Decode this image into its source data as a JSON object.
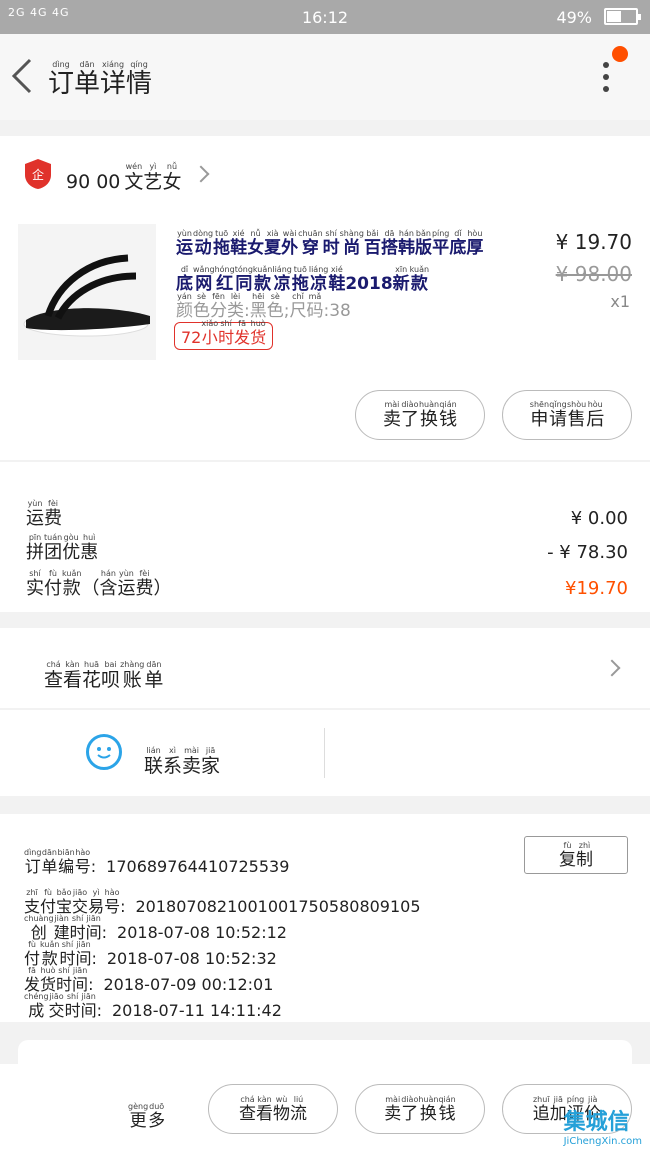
{
  "status_bar": {
    "signal": "2G 4G 4G",
    "time": "16:12",
    "battery": "49%"
  },
  "header": {
    "title": [
      {
        "py": "dìng",
        "hz": "订"
      },
      {
        "py": "dān",
        "hz": "单"
      },
      {
        "py": "xiáng",
        "hz": "详"
      },
      {
        "py": "qíng",
        "hz": "情"
      }
    ]
  },
  "shop": {
    "name_prefix": "90 00",
    "name": [
      {
        "py": "wén",
        "hz": "文"
      },
      {
        "py": "yì",
        "hz": "艺"
      },
      {
        "py": "nǚ",
        "hz": "女"
      }
    ]
  },
  "product": {
    "title_line1": [
      {
        "py": "yùn",
        "hz": "运"
      },
      {
        "py": "dòng",
        "hz": "动"
      },
      {
        "py": "tuō",
        "hz": "拖"
      },
      {
        "py": "xié",
        "hz": "鞋"
      },
      {
        "py": "nǚ",
        "hz": "女"
      },
      {
        "py": "xià",
        "hz": "夏"
      },
      {
        "py": "wài",
        "hz": "外"
      },
      {
        "py": "chuān",
        "hz": "穿"
      },
      {
        "py": "shí",
        "hz": "时"
      },
      {
        "py": "shàng",
        "hz": "尚"
      },
      {
        "py": "bǎi",
        "hz": "百"
      },
      {
        "py": "dā",
        "hz": "搭"
      },
      {
        "py": "hán",
        "hz": "韩"
      },
      {
        "py": "bǎn",
        "hz": "版"
      },
      {
        "py": "píng",
        "hz": "平"
      },
      {
        "py": "dǐ",
        "hz": "底"
      },
      {
        "py": "hòu",
        "hz": "厚"
      }
    ],
    "title_line2": [
      {
        "py": "dǐ",
        "hz": "底"
      },
      {
        "py": "wǎng",
        "hz": "网"
      },
      {
        "py": "hóng",
        "hz": "红"
      },
      {
        "py": "tóng",
        "hz": "同"
      },
      {
        "py": "kuǎn",
        "hz": "款"
      },
      {
        "py": "liáng",
        "hz": "凉"
      },
      {
        "py": "tuō",
        "hz": "拖"
      },
      {
        "py": "liáng",
        "hz": "凉"
      },
      {
        "py": "xié",
        "hz": "鞋"
      },
      {
        "py": "",
        "hz": "2018"
      },
      {
        "py": "xīn",
        "hz": "新"
      },
      {
        "py": "kuǎn",
        "hz": "款"
      }
    ],
    "spec": [
      {
        "py": "yán",
        "hz": "颜"
      },
      {
        "py": "sè",
        "hz": "色"
      },
      {
        "py": "fēn",
        "hz": "分"
      },
      {
        "py": "lèi",
        "hz": "类"
      },
      {
        "py": "",
        "hz": ":"
      },
      {
        "py": "hēi",
        "hz": "黑"
      },
      {
        "py": "sè",
        "hz": "色"
      },
      {
        "py": "",
        "hz": ";"
      },
      {
        "py": "chǐ",
        "hz": "尺"
      },
      {
        "py": "mǎ",
        "hz": "码"
      },
      {
        "py": "",
        "hz": ":38"
      }
    ],
    "tag": [
      {
        "py": "",
        "hz": "72"
      },
      {
        "py": "xiǎo",
        "hz": "小"
      },
      {
        "py": "shí",
        "hz": "时"
      },
      {
        "py": "fā",
        "hz": "发"
      },
      {
        "py": "huò",
        "hz": "货"
      }
    ],
    "price": "¥ 19.70",
    "original_price": "¥ 98.00",
    "quantity": "x1",
    "buttons": {
      "exchange": [
        {
          "py": "mài",
          "hz": "卖"
        },
        {
          "py": "diào",
          "hz": "了"
        },
        {
          "py": "huàn",
          "hz": "换"
        },
        {
          "py": "qián",
          "hz": "钱"
        }
      ],
      "after_sales": [
        {
          "py": "shēn",
          "hz": "申"
        },
        {
          "py": "qǐng",
          "hz": "请"
        },
        {
          "py": "shòu",
          "hz": "售"
        },
        {
          "py": "hòu",
          "hz": "后"
        }
      ]
    }
  },
  "fees": {
    "shipping_label": [
      {
        "py": "yùn",
        "hz": "运"
      },
      {
        "py": "fèi",
        "hz": "费"
      }
    ],
    "shipping_value": "¥ 0.00",
    "discount_label": [
      {
        "py": "pīn",
        "hz": "拼"
      },
      {
        "py": "tuán",
        "hz": "团"
      },
      {
        "py": "gòu",
        "hz": "优"
      },
      {
        "py": "huì",
        "hz": "惠"
      }
    ],
    "discount_value": "- ¥ 78.30",
    "paid_label": [
      {
        "py": "shí",
        "hz": "实"
      },
      {
        "py": "fù",
        "hz": "付"
      },
      {
        "py": "kuǎn",
        "hz": "款"
      },
      {
        "py": "",
        "hz": "（"
      },
      {
        "py": "hán",
        "hz": "含"
      },
      {
        "py": "yùn",
        "hz": "运"
      },
      {
        "py": "fèi",
        "hz": "费"
      },
      {
        "py": "",
        "hz": "）"
      }
    ],
    "paid_value": "¥19.70",
    "accent_color": "#ff5000"
  },
  "huabei": {
    "label": [
      {
        "py": "chá",
        "hz": "查"
      },
      {
        "py": "kàn",
        "hz": "看"
      },
      {
        "py": "huā",
        "hz": "花"
      },
      {
        "py": "bai",
        "hz": "呗"
      },
      {
        "py": "zhàng",
        "hz": "账"
      },
      {
        "py": "dān",
        "hz": "单"
      }
    ]
  },
  "contact": {
    "icon": "smiley-chat-icon",
    "label": [
      {
        "py": "lián",
        "hz": "联"
      },
      {
        "py": "xì",
        "hz": "系"
      },
      {
        "py": "mài",
        "hz": "卖"
      },
      {
        "py": "jiā",
        "hz": "家"
      }
    ]
  },
  "order_info": {
    "copy_button": [
      {
        "py": "fù",
        "hz": "复"
      },
      {
        "py": "zhì",
        "hz": "制"
      }
    ],
    "rows": [
      {
        "label": [
          {
            "py": "dìng",
            "hz": "订"
          },
          {
            "py": "dān",
            "hz": "单"
          },
          {
            "py": "biān",
            "hz": "编"
          },
          {
            "py": "hào",
            "hz": "号"
          },
          {
            "py": "",
            "hz": ":"
          }
        ],
        "value": "170689764410725539"
      },
      {
        "label": [
          {
            "py": "zhī",
            "hz": "支"
          },
          {
            "py": "fù",
            "hz": "付"
          },
          {
            "py": "bǎo",
            "hz": "宝"
          },
          {
            "py": "jiāo",
            "hz": "交"
          },
          {
            "py": "yì",
            "hz": "易"
          },
          {
            "py": "hào",
            "hz": "号"
          },
          {
            "py": "",
            "hz": ":"
          }
        ],
        "value": "2018070821001001750580809105"
      },
      {
        "label": [
          {
            "py": "chuàng",
            "hz": "创"
          },
          {
            "py": "jiàn",
            "hz": "建"
          },
          {
            "py": "shí",
            "hz": "时"
          },
          {
            "py": "jiān",
            "hz": "间"
          },
          {
            "py": "",
            "hz": ":"
          }
        ],
        "value": "2018-07-08 10:52:12"
      },
      {
        "label": [
          {
            "py": "fù",
            "hz": "付"
          },
          {
            "py": "kuǎn",
            "hz": "款"
          },
          {
            "py": "shí",
            "hz": "时"
          },
          {
            "py": "jiān",
            "hz": "间"
          },
          {
            "py": "",
            "hz": ":"
          }
        ],
        "value": "2018-07-08 10:52:32"
      },
      {
        "label": [
          {
            "py": "fā",
            "hz": "发"
          },
          {
            "py": "huò",
            "hz": "货"
          },
          {
            "py": "shí",
            "hz": "时"
          },
          {
            "py": "jiān",
            "hz": "间"
          },
          {
            "py": "",
            "hz": ":"
          }
        ],
        "value": "2018-07-09 00:12:01"
      },
      {
        "label": [
          {
            "py": "chéng",
            "hz": "成"
          },
          {
            "py": "jiāo",
            "hz": "交"
          },
          {
            "py": "shí",
            "hz": "时"
          },
          {
            "py": "jiān",
            "hz": "间"
          },
          {
            "py": "",
            "hz": ":"
          }
        ],
        "value": "2018-07-11 14:11:42"
      }
    ]
  },
  "bottom_bar": {
    "more": [
      {
        "py": "gèng",
        "hz": "更"
      },
      {
        "py": "duō",
        "hz": "多"
      }
    ],
    "logistics": [
      {
        "py": "chá",
        "hz": "查"
      },
      {
        "py": "kàn",
        "hz": "看"
      },
      {
        "py": "wù",
        "hz": "物"
      },
      {
        "py": "liú",
        "hz": "流"
      }
    ],
    "exchange": [
      {
        "py": "mài",
        "hz": "卖"
      },
      {
        "py": "diào",
        "hz": "了"
      },
      {
        "py": "huàn",
        "hz": "换"
      },
      {
        "py": "qián",
        "hz": "钱"
      }
    ],
    "review": [
      {
        "py": "zhuī",
        "hz": "追"
      },
      {
        "py": "jiā",
        "hz": "加"
      },
      {
        "py": "píng",
        "hz": "评"
      },
      {
        "py": "jià",
        "hz": "价"
      }
    ]
  },
  "watermark": {
    "main": "集城信",
    "sub": "JiChengXin.com"
  }
}
